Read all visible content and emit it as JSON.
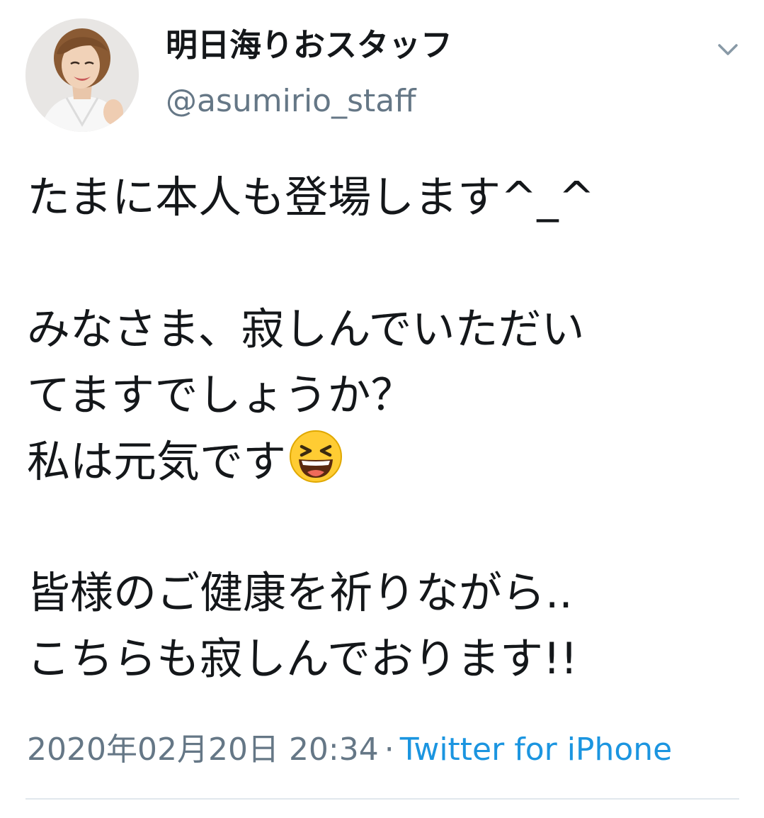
{
  "author": {
    "display_name": "明日海りおスタッフ",
    "handle": "@asumirio_staff",
    "avatar_icon": "profile-photo"
  },
  "menu": {
    "caret_icon": "chevron-down-icon"
  },
  "tweet": {
    "lines": [
      "たまに本人も登場します^_^",
      "",
      "みなさま、寂しんでいただい",
      "てますでしょうか？",
      "私は元気です",
      "",
      "皆様のご健康を祈りながら..",
      "こちらも寂しんでおります!!"
    ],
    "emoji": "grinning-squinting-face"
  },
  "meta": {
    "timestamp": "2020年02月20日 20:34",
    "separator": "·",
    "source": "Twitter for iPhone"
  },
  "colors": {
    "text_primary": "#14171a",
    "text_secondary": "#657786",
    "link": "#1b95e0",
    "divider": "#e1e8ed"
  }
}
